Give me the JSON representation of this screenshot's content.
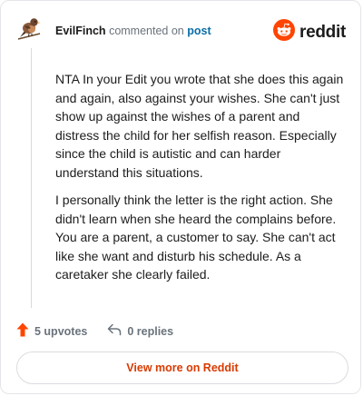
{
  "header": {
    "username": "EvilFinch",
    "action_text": "commented on",
    "post_link": "post",
    "avatar_icon": "finch-bird-icon",
    "logo_icon": "reddit-snoo-icon",
    "logo_text": "reddit"
  },
  "comment": {
    "paragraphs": [
      "NTA In your Edit you wrote that she does this again and again, also against your wishes. She can't just show up against the wishes of a parent and distress the child for her selfish reason. Especially since the child is autistic and can harder understand this situations.",
      "I personally think the letter is the right action. She didn't learn when she heard the complains before. You are a parent, a customer to say. She can't act like she want and disturb his schedule. As a caretaker she clearly failed."
    ]
  },
  "actions": {
    "upvotes_label": "5 upvotes",
    "upvote_icon": "upvote-arrow-icon",
    "replies_label": "0 replies",
    "reply_icon": "reply-arrow-icon"
  },
  "footer": {
    "view_more_label": "View more on Reddit"
  },
  "colors": {
    "brand_orange": "#ff4500",
    "link_blue": "#0a6ea8",
    "view_more_text": "#d93a00"
  }
}
